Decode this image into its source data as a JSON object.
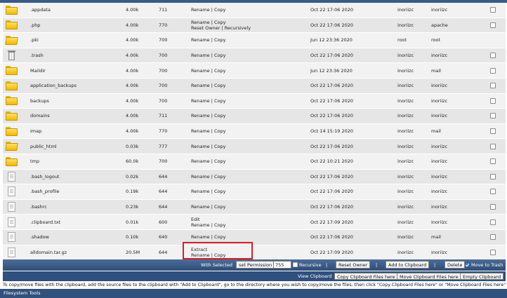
{
  "files": [
    {
      "name": ".appdata",
      "size": "4.00k",
      "perm": "711",
      "actions": [
        "Rename | Copy"
      ],
      "date": "Oct 22 17:06 2020",
      "owner": "inoriizc",
      "group": "inoriizc",
      "icon": "folder-icon",
      "checkbox": true
    },
    {
      "name": ".php",
      "size": "4.00k",
      "perm": "770",
      "actions": [
        "Rename | Copy",
        "Reset Owner | Recursively"
      ],
      "date": "Oct 22 17:06 2020",
      "owner": "inoriizc",
      "group": "apache",
      "icon": "folder-icon",
      "checkbox": true
    },
    {
      "name": ".pki",
      "size": "4.00k",
      "perm": "700",
      "actions": [
        "Rename | Copy"
      ],
      "date": "Jun 12 23:36 2020",
      "owner": "root",
      "group": "root",
      "icon": "folder-open-icon",
      "checkbox": false
    },
    {
      "name": ".trash",
      "size": "4.00k",
      "perm": "700",
      "actions": [
        "Rename | Copy"
      ],
      "date": "Oct 22 17:06 2020",
      "owner": "inoriizc",
      "group": "inoriizc",
      "icon": "trash-icon",
      "checkbox": true
    },
    {
      "name": "Maildir",
      "size": "4.00k",
      "perm": "700",
      "actions": [
        "Rename | Copy"
      ],
      "date": "Jun 12 23:36 2020",
      "owner": "inoriizc",
      "group": "mail",
      "icon": "folder-icon",
      "checkbox": true
    },
    {
      "name": "application_backups",
      "size": "4.00k",
      "perm": "700",
      "actions": [
        "Rename | Copy"
      ],
      "date": "Oct 22 17:06 2020",
      "owner": "inoriizc",
      "group": "inoriizc",
      "icon": "folder-icon",
      "checkbox": true
    },
    {
      "name": "backups",
      "size": "4.00k",
      "perm": "700",
      "actions": [
        "Rename | Copy"
      ],
      "date": "Oct 22 17:06 2020",
      "owner": "inoriizc",
      "group": "inoriizc",
      "icon": "folder-icon",
      "checkbox": true
    },
    {
      "name": "domains",
      "size": "4.00k",
      "perm": "711",
      "actions": [
        "Rename | Copy"
      ],
      "date": "Oct 22 17:06 2020",
      "owner": "inoriizc",
      "group": "inoriizc",
      "icon": "folder-icon",
      "checkbox": true
    },
    {
      "name": "imap",
      "size": "4.00k",
      "perm": "770",
      "actions": [
        "Rename | Copy"
      ],
      "date": "Oct 14 15:19 2020",
      "owner": "inoriizc",
      "group": "mail",
      "icon": "folder-icon",
      "checkbox": true
    },
    {
      "name": "public_html",
      "size": "0.03k",
      "perm": "777",
      "actions": [
        "Rename | Copy"
      ],
      "date": "Oct 22 17:06 2020",
      "owner": "inoriizc",
      "group": "inoriizc",
      "icon": "folder-open-icon",
      "checkbox": true
    },
    {
      "name": "tmp",
      "size": "60.0k",
      "perm": "700",
      "actions": [
        "Rename | Copy"
      ],
      "date": "Oct 22 10:21 2020",
      "owner": "inoriizc",
      "group": "inoriizc",
      "icon": "folder-icon",
      "checkbox": true
    },
    {
      "name": ".bash_logout",
      "size": "0.02k",
      "perm": "644",
      "actions": [
        "Rename | Copy"
      ],
      "date": "Oct 22 17:06 2020",
      "owner": "inoriizc",
      "group": "inoriizc",
      "icon": "file-icon",
      "checkbox": true
    },
    {
      "name": ".bash_profile",
      "size": "0.19k",
      "perm": "644",
      "actions": [
        "Rename | Copy"
      ],
      "date": "Oct 22 17:06 2020",
      "owner": "inoriizc",
      "group": "inoriizc",
      "icon": "file-icon",
      "checkbox": true
    },
    {
      "name": ".bashrc",
      "size": "0.23k",
      "perm": "644",
      "actions": [
        "Rename | Copy"
      ],
      "date": "Oct 22 17:06 2020",
      "owner": "inoriizc",
      "group": "inoriizc",
      "icon": "file-icon",
      "checkbox": true
    },
    {
      "name": ".clipboard.txt",
      "size": "0.01k",
      "perm": "600",
      "actions": [
        "Edit",
        "Rename | Copy"
      ],
      "date": "Oct 22 17:09 2020",
      "owner": "inoriizc",
      "group": "inoriizc",
      "icon": "file-icon",
      "checkbox": true
    },
    {
      "name": ".shadow",
      "size": "0.10k",
      "perm": "640",
      "actions": [
        "Rename | Copy"
      ],
      "date": "Oct 22 17:06 2020",
      "owner": "inoriizc",
      "group": "mail",
      "icon": "file-icon",
      "checkbox": true
    },
    {
      "name": "alldomain.tar.gz",
      "size": "20.5M",
      "perm": "644",
      "actions": [
        "Extract",
        "Rename | Copy"
      ],
      "date": "Oct 22 17:09 2020",
      "owner": "inoriizc",
      "group": "inoriizc",
      "icon": "file-icon",
      "checkbox": true
    }
  ],
  "actions_bar": {
    "with_selected": "With Selected",
    "set_permission": "set Permission",
    "permission_value": "755",
    "recursive": "Recursive",
    "separator": "|",
    "reset_owner": "Reset Owner",
    "add_to_clipboard": "Add to Clipboard",
    "delete": "Delete",
    "move_to_trash": "Move to Trash"
  },
  "clipboard_bar": {
    "view_clipboard": "View Clipboard",
    "copy_here": "Copy Clipboard Files here",
    "move_here": "Move Clipboard Files here",
    "empty": "Empty Clipboard"
  },
  "help_text": "To copy/move files with the clipboard, add the source files to the clipboard with \"Add to Clipboard\", go to the directory where you wish to copy/move the files, then click \"Copy Clipboard Files here\" or \"Move Clipboard Files here\"",
  "filesystem_tools": "Filesystem Tools",
  "colors": {
    "header_bar": "#3b5b85",
    "highlight_border": "#d4202a",
    "row_odd": "#f2f2f2",
    "row_even": "#e6e6e6"
  }
}
